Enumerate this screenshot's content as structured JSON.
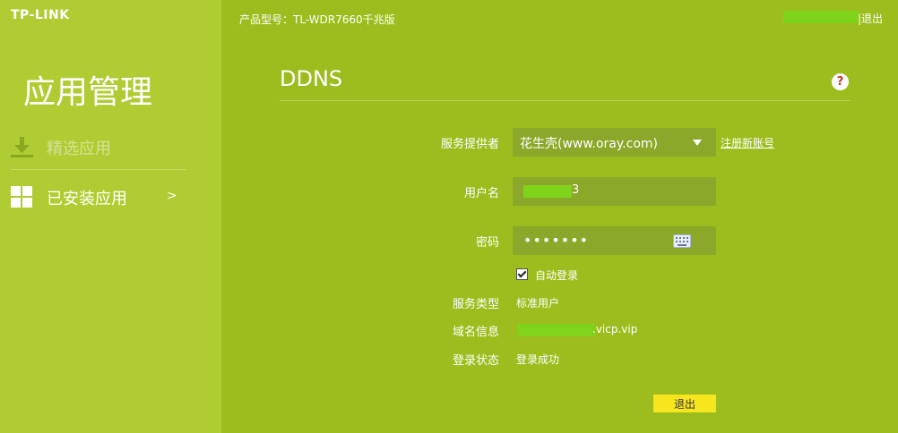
{
  "brand": {
    "logo": "TP-LINK"
  },
  "sidebar": {
    "title": "应用管理",
    "items": [
      {
        "label": "精选应用",
        "icon": "download-icon"
      },
      {
        "label": "已安装应用",
        "icon": "grid-icon",
        "chevron": ">"
      }
    ]
  },
  "header": {
    "model": "产品型号：TL-WDR7660千兆版",
    "logout_label": "|退出"
  },
  "page": {
    "title": "DDNS",
    "help_label": "?"
  },
  "form": {
    "provider_label": "服务提供者",
    "provider_value": "花生壳(www.oray.com)",
    "register_link": "注册新账号",
    "username_label": "用户名",
    "username_tail": "3",
    "password_label": "密码",
    "password_value": "•••••••",
    "auto_login_label": "自动登录",
    "auto_login_checked": true,
    "service_type_label": "服务类型",
    "service_type_value": "标准用户",
    "domain_label": "域名信息",
    "domain_value": ".vicp.vip",
    "login_status_label": "登录状态",
    "login_status_value": "登录成功",
    "logout_button": "退出"
  },
  "colors": {
    "sidebar_bg": "#b0cc33",
    "main_bg": "#9dbd1f",
    "field_bg": "#8ca82a",
    "button_bg": "#f7e61d"
  }
}
